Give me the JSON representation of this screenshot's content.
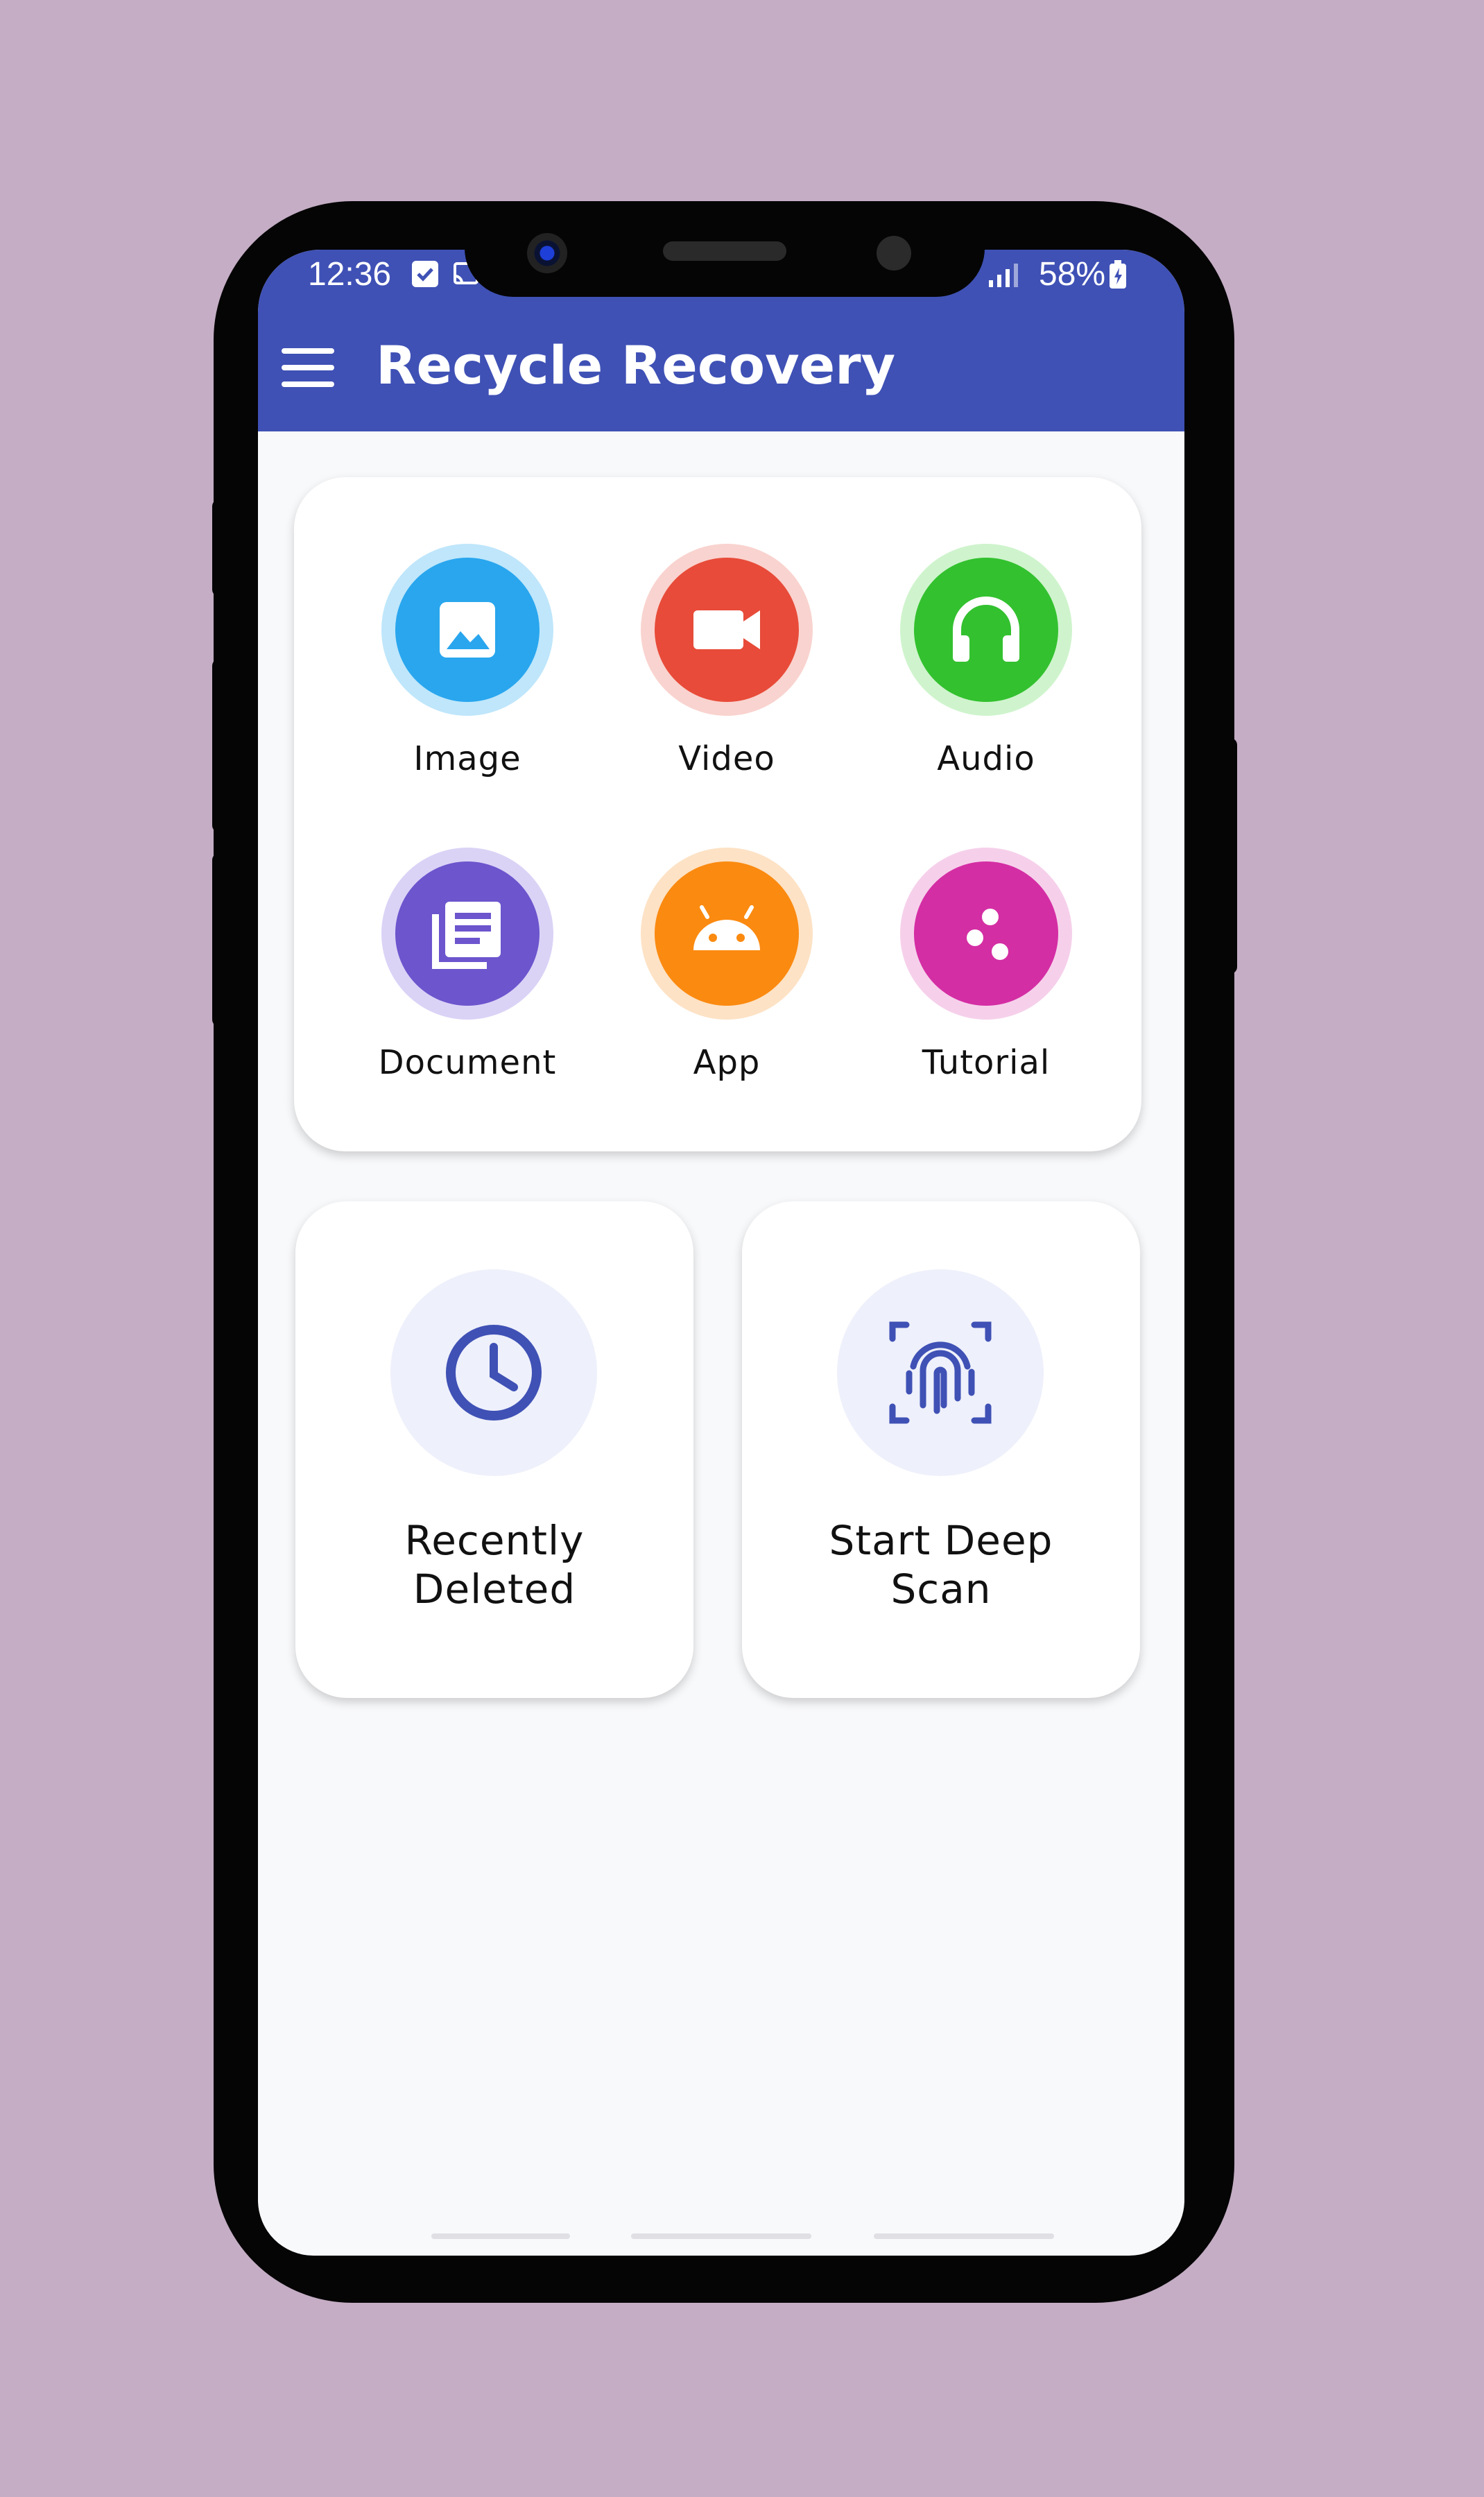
{
  "colors": {
    "background": "#c5adc5",
    "primary": "#3f51b5",
    "image": "#29a6ee",
    "video": "#e84b39",
    "audio": "#33c12f",
    "document": "#6c55cd",
    "app": "#fb8a10",
    "tutorial": "#d42ea4"
  },
  "status_bar": {
    "time": "12:36",
    "battery": "58%",
    "icons": [
      "check-box-icon",
      "cast-icon",
      "wifi-icon",
      "signal-icon",
      "battery-charging-icon"
    ]
  },
  "app_bar": {
    "title": "Recycle Recovery",
    "menu_icon": "hamburger-menu-icon"
  },
  "categories": [
    {
      "label": "Image",
      "icon": "image-icon",
      "color": "#29a6ee",
      "ring": "#bfe6fb"
    },
    {
      "label": "Video",
      "icon": "videocam-icon",
      "color": "#e84b39",
      "ring": "#f9d3cf"
    },
    {
      "label": "Audio",
      "icon": "headphones-icon",
      "color": "#33c12f",
      "ring": "#cff4cd"
    },
    {
      "label": "Document",
      "icon": "library-books-icon",
      "color": "#6c55cd",
      "ring": "#dbd3f6"
    },
    {
      "label": "App",
      "icon": "android-icon",
      "color": "#fb8a10",
      "ring": "#fde2c5"
    },
    {
      "label": "Tutorial",
      "icon": "dots-icon",
      "color": "#d42ea4",
      "ring": "#f6d0eb"
    }
  ],
  "actions": [
    {
      "label_line1": "Recently",
      "label_line2": "Deleted",
      "icon": "clock-icon"
    },
    {
      "label_line1": "Start Deep",
      "label_line2": "Scan",
      "icon": "fingerprint-scan-icon"
    }
  ]
}
